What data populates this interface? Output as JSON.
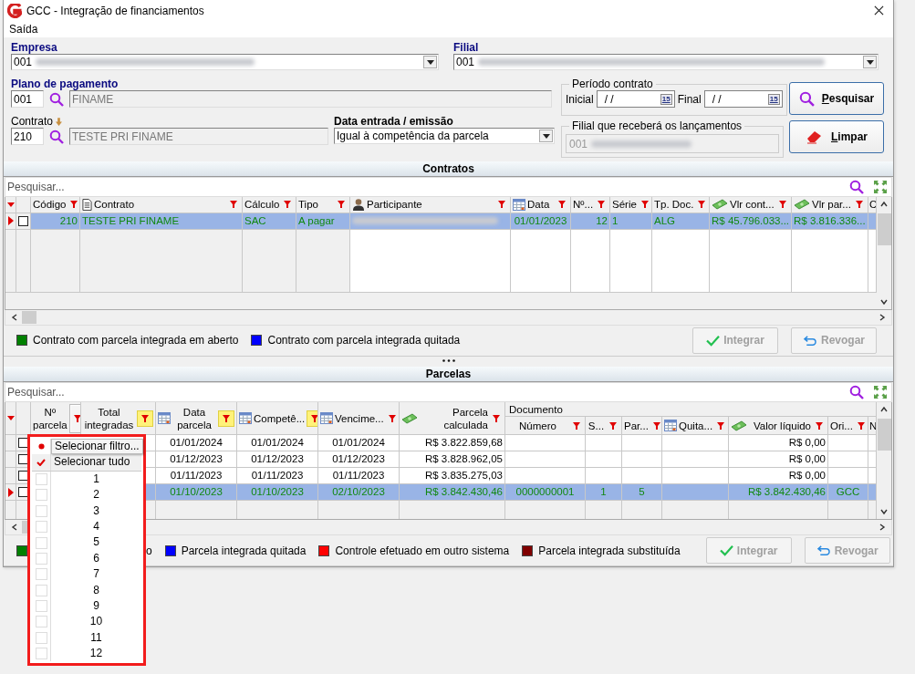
{
  "window": {
    "title": "GCC - Integração de financiamentos"
  },
  "menu": [
    {
      "label": "Saída"
    }
  ],
  "form": {
    "empresa": {
      "label": "Empresa",
      "value": "001"
    },
    "filial": {
      "label": "Filial",
      "value": "001"
    },
    "plano_pagamento": {
      "label": "Plano de pagamento",
      "code": "001",
      "name": "FINAME"
    },
    "contrato": {
      "label": "Contrato",
      "code": "210",
      "name": "TESTE PRI FINAME"
    },
    "data_entrada": {
      "label": "Data entrada / emissão",
      "value": "Igual à competência da parcela"
    },
    "periodo_contrato": {
      "legend": "Período contrato",
      "fields": [
        {
          "label": "Inicial",
          "value": "/ /",
          "picker": "15"
        },
        {
          "label": "Final",
          "value": "/ /",
          "picker": "15"
        }
      ]
    },
    "filial_lancamentos": {
      "legend": "Filial que receberá os lançamentos",
      "value": "001"
    },
    "buttons": [
      {
        "label": "Pesquisar",
        "kind": "search"
      },
      {
        "label": "Limpar",
        "kind": "clear"
      }
    ]
  },
  "contratos": {
    "title": "Contratos",
    "search": {
      "placeholder": "Pesquisar..."
    },
    "columns": [
      {
        "label": "Código",
        "kind": "text",
        "filter": true
      },
      {
        "label": "Contrato",
        "kind": "text",
        "filter": true
      },
      {
        "label": "Cálculo",
        "kind": "text",
        "filter": true
      },
      {
        "label": "Tipo",
        "kind": "text",
        "filter": true
      },
      {
        "label": "Participante",
        "kind": "redacted",
        "filter": true
      },
      {
        "label": "Data",
        "kind": "text",
        "filter": true
      },
      {
        "label": "Nº...",
        "kind": "text",
        "filter": true
      },
      {
        "label": "Série",
        "kind": "text",
        "filter": true
      },
      {
        "label": "Tp. Doc.",
        "kind": "text",
        "filter": true
      },
      {
        "label": "Vlr cont...",
        "kind": "text",
        "filter": true
      },
      {
        "label": "Vlr par...",
        "kind": "text",
        "filter": true
      },
      {
        "label": "C",
        "kind": "text"
      }
    ],
    "rows": [
      {
        "selected": true,
        "checked": false,
        "color": "#118811",
        "cells": [
          "210",
          "TESTE PRI FINAME",
          "SAC",
          "A pagar",
          null,
          "01/01/2023",
          "12",
          "1",
          "ALG",
          "R$ 45.796.033...",
          "R$ 3.816.336..."
        ]
      }
    ],
    "legend": [
      {
        "label": "Contrato com parcela integrada em aberto",
        "color": "#008000"
      },
      {
        "label": "Contrato com parcela integrada quitada",
        "color": "#0000ff"
      }
    ],
    "buttons": [
      {
        "label": "Integrar",
        "kind": "integrate",
        "disabled": true
      },
      {
        "label": "Revogar",
        "kind": "revoke",
        "disabled": true
      }
    ]
  },
  "parcelas": {
    "title": "Parcelas",
    "search": {
      "placeholder": "Pesquisar..."
    },
    "group_header": "Documento",
    "columns": [
      {
        "label": "Nº parcela",
        "filter": true,
        "filter_active": false,
        "filter_open": true
      },
      {
        "label": "Total integradas",
        "filter": true,
        "filter_active": true,
        "filter_open": false
      },
      {
        "label": "Data parcela",
        "filter": true,
        "filter_active": true,
        "filter_open": false
      },
      {
        "label": "Competê...",
        "filter": true,
        "filter_active": true,
        "filter_open": false
      },
      {
        "label": "Vencime...",
        "filter": true,
        "filter_active": false,
        "filter_open": false
      },
      {
        "label": "Parcela calculada",
        "filter": true,
        "filter_active": false,
        "filter_open": false
      },
      {
        "label": "Número",
        "filter": true,
        "filter_active": false,
        "filter_open": false
      },
      {
        "label": "S...",
        "filter": true,
        "filter_active": false,
        "filter_open": false
      },
      {
        "label": "Par...",
        "filter": true,
        "filter_active": false,
        "filter_open": false
      },
      {
        "label": "Quita...",
        "filter": true,
        "filter_active": false,
        "filter_open": false
      },
      {
        "label": "Valor líquido",
        "filter": true,
        "filter_active": false,
        "filter_open": false
      },
      {
        "label": "Ori...",
        "filter": true,
        "filter_active": false,
        "filter_open": false
      },
      {
        "label": "N"
      }
    ],
    "rows": [
      {
        "selected": false,
        "checked": false,
        "color": "#000000",
        "cells": [
          null,
          null,
          "01/01/2024",
          "01/01/2024",
          "01/01/2024",
          "R$ 3.822.859,68",
          null,
          null,
          null,
          null,
          "R$ 0,00"
        ]
      },
      {
        "selected": false,
        "checked": false,
        "color": "#000000",
        "cells": [
          null,
          null,
          "01/12/2023",
          "01/12/2023",
          "01/12/2023",
          "R$ 3.828.962,05",
          null,
          null,
          null,
          null,
          "R$ 0,00"
        ]
      },
      {
        "selected": false,
        "checked": false,
        "color": "#000000",
        "cells": [
          null,
          null,
          "01/11/2023",
          "01/11/2023",
          "01/11/2023",
          "R$ 3.835.275,03",
          null,
          null,
          null,
          null,
          "R$ 0,00"
        ]
      },
      {
        "selected": true,
        "checked": false,
        "color": "#118811",
        "cells": [
          null,
          null,
          "01/10/2023",
          "01/10/2023",
          "02/10/2023",
          "R$ 3.842.430,46",
          "0000000001",
          "1",
          "5",
          null,
          "R$ 3.842.430,46",
          "GCC"
        ]
      }
    ],
    "legend": [
      {
        "label": "o",
        "color": "#008000"
      },
      {
        "label": "Parcela integrada quitada",
        "color": "#0000ff"
      },
      {
        "label": "Controle efetuado em outro sistema",
        "color": "#ff0000"
      },
      {
        "label": "Parcela integrada substituída",
        "color": "#800000"
      }
    ],
    "buttons": [
      {
        "label": "Integrar",
        "kind": "integrate",
        "disabled": true
      },
      {
        "label": "Revogar",
        "kind": "revoke",
        "disabled": true
      }
    ]
  },
  "filter_popup": {
    "items": [
      {
        "kind": "action",
        "label": "Selecionar filtro..."
      },
      {
        "kind": "select_all",
        "label": "Selecionar tudo",
        "checked": true
      },
      {
        "kind": "value",
        "label": "1",
        "checked": false
      },
      {
        "kind": "value",
        "label": "2",
        "checked": false
      },
      {
        "kind": "value",
        "label": "3",
        "checked": false
      },
      {
        "kind": "value",
        "label": "4",
        "checked": false
      },
      {
        "kind": "value",
        "label": "5",
        "checked": false
      },
      {
        "kind": "value",
        "label": "6",
        "checked": false
      },
      {
        "kind": "value",
        "label": "7",
        "checked": false
      },
      {
        "kind": "value",
        "label": "8",
        "checked": false
      },
      {
        "kind": "value",
        "label": "9",
        "checked": false
      },
      {
        "kind": "value",
        "label": "10",
        "checked": false
      },
      {
        "kind": "value",
        "label": "11",
        "checked": false
      },
      {
        "kind": "value",
        "label": "12",
        "checked": false
      }
    ]
  }
}
